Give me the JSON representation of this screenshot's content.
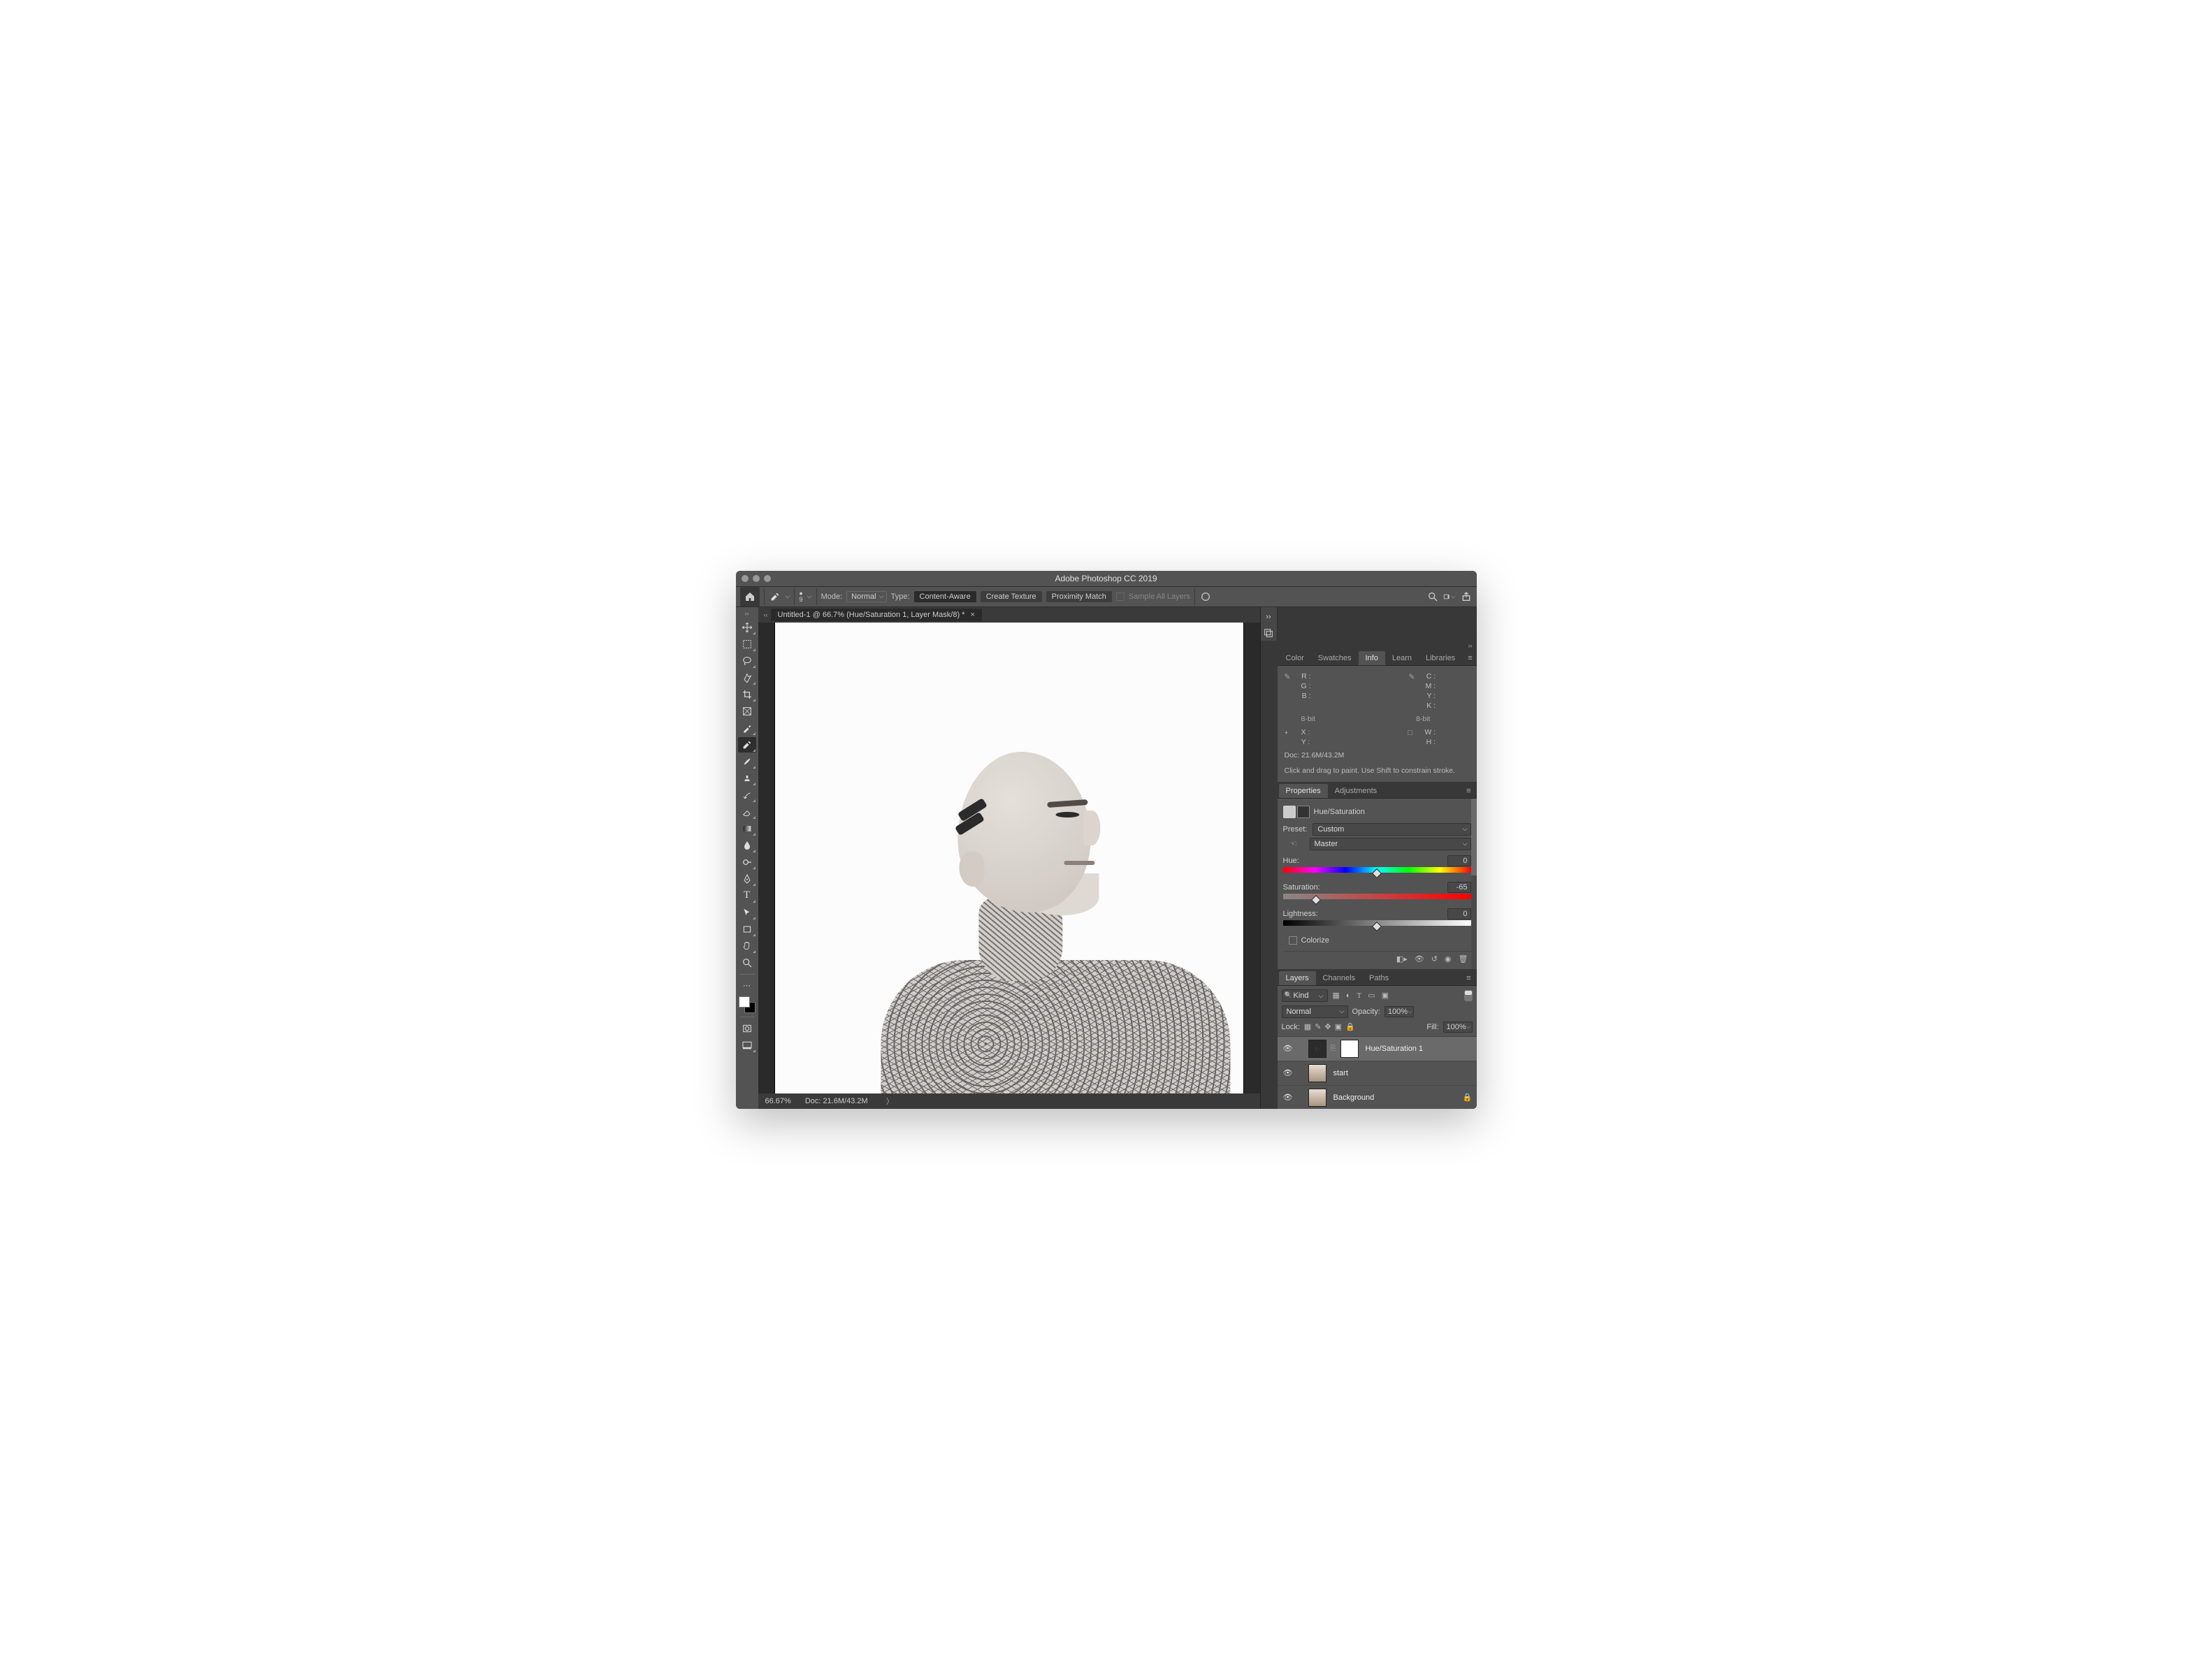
{
  "window_title": "Adobe Photoshop CC 2019",
  "options_bar": {
    "brush_size": "9",
    "mode_label": "Mode:",
    "mode_value": "Normal",
    "type_label": "Type:",
    "btn_content_aware": "Content-Aware",
    "btn_create_texture": "Create Texture",
    "btn_proximity_match": "Proximity Match",
    "sample_all_label": "Sample All Layers"
  },
  "document": {
    "tab_title": "Untitled-1 @ 66.7% (Hue/Saturation 1, Layer Mask/8) *",
    "zoom": "66.67%",
    "doc_size": "Doc: 21.6M/43.2M"
  },
  "info_panel": {
    "tabs": [
      "Color",
      "Swatches",
      "Info",
      "Learn",
      "Libraries"
    ],
    "active_tab": "Info",
    "rgb": {
      "R": "R :",
      "G": "G :",
      "B": "B :"
    },
    "cmyk": {
      "C": "C :",
      "M": "M :",
      "Y": "Y :",
      "K": "K :"
    },
    "eight_bit": "8-bit",
    "xy": {
      "X": "X :",
      "Y": "Y :"
    },
    "wh": {
      "W": "W :",
      "H": "H :"
    },
    "doc_line": "Doc: 21.6M/43.2M",
    "hint": "Click and drag to paint. Use Shift to constrain stroke."
  },
  "properties_panel": {
    "tabs": [
      "Properties",
      "Adjustments"
    ],
    "active_tab": "Properties",
    "adj_name": "Hue/Saturation",
    "preset_label": "Preset:",
    "preset_value": "Custom",
    "channel_value": "Master",
    "hue_label": "Hue:",
    "hue_value": "0",
    "sat_label": "Saturation:",
    "sat_value": "-65",
    "lig_label": "Lightness:",
    "lig_value": "0",
    "colorize_label": "Colorize"
  },
  "layers_panel": {
    "tabs": [
      "Layers",
      "Channels",
      "Paths"
    ],
    "active_tab": "Layers",
    "kind_label": "Kind",
    "blend_mode": "Normal",
    "opacity_label": "Opacity:",
    "opacity_value": "100%",
    "lock_label": "Lock:",
    "fill_label": "Fill:",
    "fill_value": "100%",
    "layers": [
      {
        "name": "Hue/Saturation 1",
        "type": "adjustment",
        "selected": true,
        "locked": false
      },
      {
        "name": "start",
        "type": "image",
        "selected": false,
        "locked": false
      },
      {
        "name": "Background",
        "type": "image",
        "selected": false,
        "locked": true
      }
    ]
  }
}
